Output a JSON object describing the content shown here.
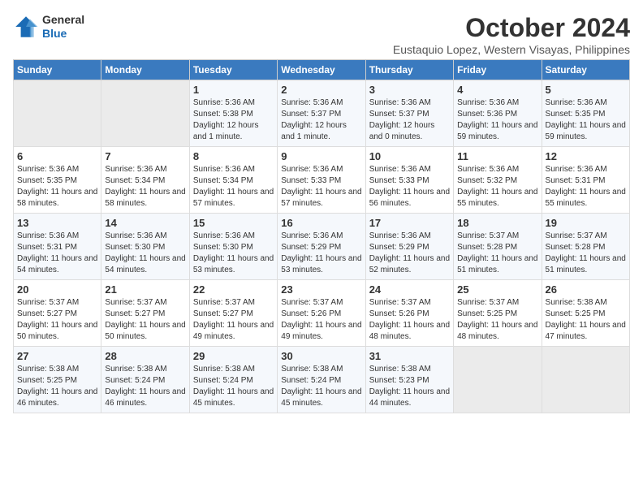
{
  "logo": {
    "line1": "General",
    "line2": "Blue"
  },
  "title": "October 2024",
  "location": "Eustaquio Lopez, Western Visayas, Philippines",
  "days_of_week": [
    "Sunday",
    "Monday",
    "Tuesday",
    "Wednesday",
    "Thursday",
    "Friday",
    "Saturday"
  ],
  "weeks": [
    [
      {
        "day": "",
        "empty": true
      },
      {
        "day": "",
        "empty": true
      },
      {
        "day": "1",
        "sunrise": "5:36 AM",
        "sunset": "5:38 PM",
        "daylight": "12 hours and 1 minute."
      },
      {
        "day": "2",
        "sunrise": "5:36 AM",
        "sunset": "5:37 PM",
        "daylight": "12 hours and 1 minute."
      },
      {
        "day": "3",
        "sunrise": "5:36 AM",
        "sunset": "5:37 PM",
        "daylight": "12 hours and 0 minutes."
      },
      {
        "day": "4",
        "sunrise": "5:36 AM",
        "sunset": "5:36 PM",
        "daylight": "11 hours and 59 minutes."
      },
      {
        "day": "5",
        "sunrise": "5:36 AM",
        "sunset": "5:35 PM",
        "daylight": "11 hours and 59 minutes."
      }
    ],
    [
      {
        "day": "6",
        "sunrise": "5:36 AM",
        "sunset": "5:35 PM",
        "daylight": "11 hours and 58 minutes."
      },
      {
        "day": "7",
        "sunrise": "5:36 AM",
        "sunset": "5:34 PM",
        "daylight": "11 hours and 58 minutes."
      },
      {
        "day": "8",
        "sunrise": "5:36 AM",
        "sunset": "5:34 PM",
        "daylight": "11 hours and 57 minutes."
      },
      {
        "day": "9",
        "sunrise": "5:36 AM",
        "sunset": "5:33 PM",
        "daylight": "11 hours and 57 minutes."
      },
      {
        "day": "10",
        "sunrise": "5:36 AM",
        "sunset": "5:33 PM",
        "daylight": "11 hours and 56 minutes."
      },
      {
        "day": "11",
        "sunrise": "5:36 AM",
        "sunset": "5:32 PM",
        "daylight": "11 hours and 55 minutes."
      },
      {
        "day": "12",
        "sunrise": "5:36 AM",
        "sunset": "5:31 PM",
        "daylight": "11 hours and 55 minutes."
      }
    ],
    [
      {
        "day": "13",
        "sunrise": "5:36 AM",
        "sunset": "5:31 PM",
        "daylight": "11 hours and 54 minutes."
      },
      {
        "day": "14",
        "sunrise": "5:36 AM",
        "sunset": "5:30 PM",
        "daylight": "11 hours and 54 minutes."
      },
      {
        "day": "15",
        "sunrise": "5:36 AM",
        "sunset": "5:30 PM",
        "daylight": "11 hours and 53 minutes."
      },
      {
        "day": "16",
        "sunrise": "5:36 AM",
        "sunset": "5:29 PM",
        "daylight": "11 hours and 53 minutes."
      },
      {
        "day": "17",
        "sunrise": "5:36 AM",
        "sunset": "5:29 PM",
        "daylight": "11 hours and 52 minutes."
      },
      {
        "day": "18",
        "sunrise": "5:37 AM",
        "sunset": "5:28 PM",
        "daylight": "11 hours and 51 minutes."
      },
      {
        "day": "19",
        "sunrise": "5:37 AM",
        "sunset": "5:28 PM",
        "daylight": "11 hours and 51 minutes."
      }
    ],
    [
      {
        "day": "20",
        "sunrise": "5:37 AM",
        "sunset": "5:27 PM",
        "daylight": "11 hours and 50 minutes."
      },
      {
        "day": "21",
        "sunrise": "5:37 AM",
        "sunset": "5:27 PM",
        "daylight": "11 hours and 50 minutes."
      },
      {
        "day": "22",
        "sunrise": "5:37 AM",
        "sunset": "5:27 PM",
        "daylight": "11 hours and 49 minutes."
      },
      {
        "day": "23",
        "sunrise": "5:37 AM",
        "sunset": "5:26 PM",
        "daylight": "11 hours and 49 minutes."
      },
      {
        "day": "24",
        "sunrise": "5:37 AM",
        "sunset": "5:26 PM",
        "daylight": "11 hours and 48 minutes."
      },
      {
        "day": "25",
        "sunrise": "5:37 AM",
        "sunset": "5:25 PM",
        "daylight": "11 hours and 48 minutes."
      },
      {
        "day": "26",
        "sunrise": "5:38 AM",
        "sunset": "5:25 PM",
        "daylight": "11 hours and 47 minutes."
      }
    ],
    [
      {
        "day": "27",
        "sunrise": "5:38 AM",
        "sunset": "5:25 PM",
        "daylight": "11 hours and 46 minutes."
      },
      {
        "day": "28",
        "sunrise": "5:38 AM",
        "sunset": "5:24 PM",
        "daylight": "11 hours and 46 minutes."
      },
      {
        "day": "29",
        "sunrise": "5:38 AM",
        "sunset": "5:24 PM",
        "daylight": "11 hours and 45 minutes."
      },
      {
        "day": "30",
        "sunrise": "5:38 AM",
        "sunset": "5:24 PM",
        "daylight": "11 hours and 45 minutes."
      },
      {
        "day": "31",
        "sunrise": "5:38 AM",
        "sunset": "5:23 PM",
        "daylight": "11 hours and 44 minutes."
      },
      {
        "day": "",
        "empty": true
      },
      {
        "day": "",
        "empty": true
      }
    ]
  ]
}
